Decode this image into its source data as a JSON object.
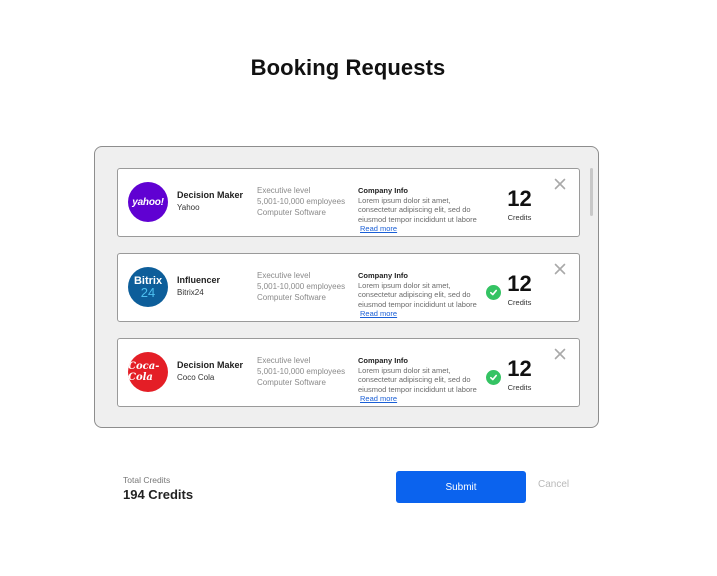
{
  "page": {
    "title": "Booking Requests"
  },
  "requests": [
    {
      "logo_text": "yahoo!",
      "logo_color": "#6001d2",
      "role": "Decision Maker",
      "company": "Yahoo",
      "meta": [
        "Executive level",
        "5,001-10,000 employees",
        "Computer Software"
      ],
      "info_title": "Company Info",
      "info_text": "Lorem ipsum dolor sit amet, consectetur adipiscing elit, sed do eiusmod tempor incididunt ut labore",
      "read_more": "Read more",
      "credits": "12",
      "credits_label": "Credits",
      "selected": false
    },
    {
      "logo_text_1": "Bitrix",
      "logo_text_2": "24",
      "logo_color": "#0d5e9a",
      "role": "Influencer",
      "company": "Bitrix24",
      "meta": [
        "Executive level",
        "5,001-10,000 employees",
        "Computer Software"
      ],
      "info_title": "Company Info",
      "info_text": "Lorem ipsum dolor sit amet, consectetur adipiscing elit, sed do eiusmod tempor incididunt ut labore",
      "read_more": "Read more",
      "credits": "12",
      "credits_label": "Credits",
      "selected": true
    },
    {
      "logo_text": "Coca-Cola",
      "logo_color": "#e41e26",
      "role": "Decision Maker",
      "company": "Coco Cola",
      "meta": [
        "Executive level",
        "5,001-10,000 employees",
        "Computer Software"
      ],
      "info_title": "Company Info",
      "info_text": "Lorem ipsum dolor sit amet, consectetur adipiscing elit, sed do eiusmod tempor incididunt ut labore",
      "read_more": "Read more",
      "credits": "12",
      "credits_label": "Credits",
      "selected": true
    }
  ],
  "footer": {
    "total_label": "Total Credits",
    "total_value": "194 Credits",
    "submit_label": "Submit",
    "cancel_label": "Cancel"
  },
  "colors": {
    "accent": "#0b63ee",
    "check": "#34c363"
  }
}
